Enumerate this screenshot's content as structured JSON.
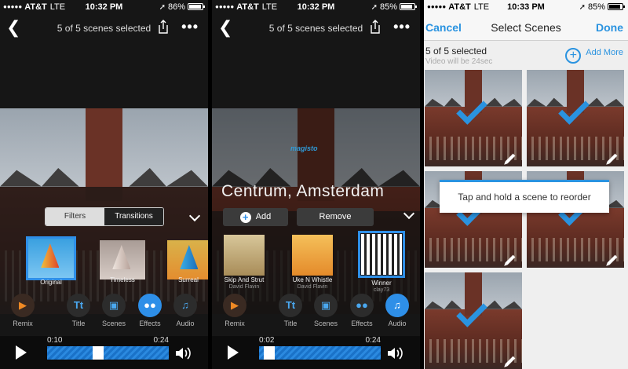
{
  "screens": [
    {
      "status": {
        "carrier": "AT&T",
        "network": "LTE",
        "time": "10:32 PM",
        "battery": "86%",
        "battery_level": 0.86
      },
      "header": {
        "title": "5 of 5 scenes selected"
      },
      "segment": {
        "filters": "Filters",
        "transitions": "Transitions",
        "selected": "Filters"
      },
      "filters": [
        {
          "label": "Original",
          "selected": true
        },
        {
          "label": "Timeless",
          "selected": false
        },
        {
          "label": "Surreal",
          "selected": false
        }
      ],
      "tools": [
        {
          "label": "Remix",
          "icon": "remix-icon"
        },
        {
          "label": "Title",
          "icon": "title-icon"
        },
        {
          "label": "Scenes",
          "icon": "scenes-icon"
        },
        {
          "label": "Effects",
          "icon": "effects-icon",
          "active": true
        },
        {
          "label": "Audio",
          "icon": "music-note-icon"
        }
      ],
      "player": {
        "current": "0:10",
        "total": "0:24",
        "progress": 0.42
      }
    },
    {
      "status": {
        "carrier": "AT&T",
        "network": "LTE",
        "time": "10:32 PM",
        "battery": "85%",
        "battery_level": 0.85
      },
      "header": {
        "title": "5 of 5 scenes selected"
      },
      "overlay_title": "Centrum, Amsterdam",
      "watermark": "magisto",
      "buttons": {
        "add": "Add",
        "remove": "Remove"
      },
      "albums": [
        {
          "title": "Skip And Strut",
          "artist": "David Flavin",
          "selected": false,
          "color": "#c9b27a"
        },
        {
          "title": "Uke N Whistle",
          "artist": "David Flavin",
          "selected": false,
          "color": "#f0a43a"
        },
        {
          "title": "Winner",
          "artist": "clay73",
          "selected": true,
          "color": "#2a2a2a"
        }
      ],
      "tools": [
        {
          "label": "Remix"
        },
        {
          "label": "Title"
        },
        {
          "label": "Scenes"
        },
        {
          "label": "Effects"
        },
        {
          "label": "Audio",
          "active": true
        }
      ],
      "player": {
        "current": "0:02",
        "total": "0:24",
        "progress": 0.04
      }
    },
    {
      "status": {
        "carrier": "AT&T",
        "network": "LTE",
        "time": "10:33 PM",
        "battery": "85%",
        "battery_level": 0.85
      },
      "nav": {
        "cancel": "Cancel",
        "title": "Select Scenes",
        "done": "Done"
      },
      "count": "5 of 5 selected",
      "subtitle": "Video will be 24sec",
      "add_more": "Add More",
      "tooltip": "Tap and hold a scene to reorder",
      "scenes": [
        {
          "selected": true
        },
        {
          "selected": true
        },
        {
          "selected": true
        },
        {
          "selected": true
        },
        {
          "selected": true
        }
      ]
    }
  ],
  "colors": {
    "accent": "#2e8fe8",
    "ios_blue": "#2a93e0",
    "remix_orange": "#f08a24"
  }
}
